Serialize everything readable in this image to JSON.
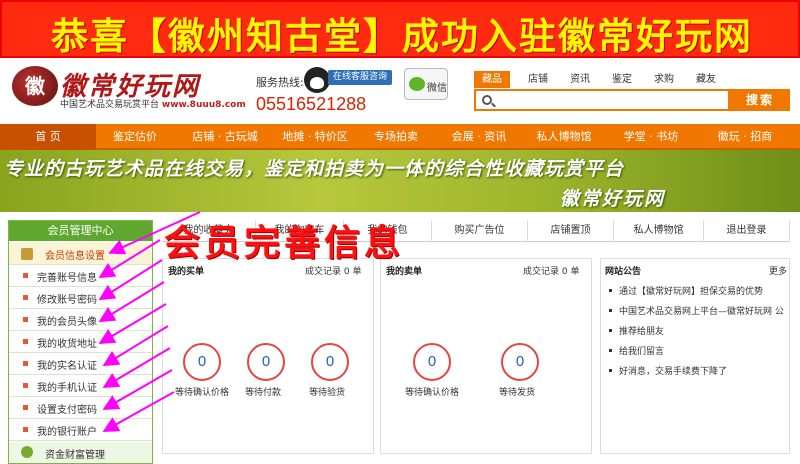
{
  "banner": {
    "text": "恭喜【徽州知古堂】成功入驻徽常好玩网"
  },
  "logo": {
    "mark": "徽",
    "name": "徽常好玩网",
    "tagline": "中国艺术品交易玩赏平台",
    "domain": "www.8uuu8.com"
  },
  "header": {
    "hotline_label": "服务热线:",
    "qq_button": "在线客服咨询",
    "phone": "05516521288",
    "wechat_label": "微信"
  },
  "search": {
    "tabs": [
      "藏品",
      "店铺",
      "资讯",
      "鉴定",
      "求购",
      "藏友"
    ],
    "active_tab": "藏品",
    "placeholder": "",
    "button": "搜索"
  },
  "nav": [
    "首 页",
    "鉴定估价",
    "店铺 · 古玩城",
    "地摊 · 特价区",
    "专场拍卖",
    "会展 · 资讯",
    "私人博物馆",
    "学堂 · 书坊",
    "徽玩 · 招商"
  ],
  "slogan": {
    "line1": "专业的古玩艺术品在线交易，鉴定和拍卖为一体的综合性收藏玩赏平台",
    "line2": "徽常好玩网"
  },
  "sidebar": {
    "header": "会员管理中心",
    "items": [
      "会员信息设置",
      "完善账号信息",
      "修改账号密码",
      "我的会员头像",
      "我的收货地址",
      "我的实名认证",
      "我的手机认证",
      "设置支付密码",
      "我的银行账户"
    ],
    "footer": "资金财富管理"
  },
  "tabs": [
    "我的收藏夹",
    "我的淘宝车",
    "我的钱包",
    "购买广告位",
    "店铺置顶",
    "私人博物馆",
    "退出登录"
  ],
  "buy_panel": {
    "title": "我的买单",
    "record_label": "成交记录",
    "record_count": "0",
    "record_unit": "单",
    "counters": [
      {
        "value": "0",
        "label": "等待确认价格"
      },
      {
        "value": "0",
        "label": "等待付款"
      },
      {
        "value": "0",
        "label": "等待验货"
      }
    ]
  },
  "sell_panel": {
    "title": "我的卖单",
    "record_label": "成交记录",
    "record_count": "0",
    "record_unit": "单",
    "counters": [
      {
        "value": "0",
        "label": "等待确认价格"
      },
      {
        "value": "0",
        "label": "等待发货"
      }
    ]
  },
  "news": {
    "title": "网站公告",
    "more": "更多",
    "items": [
      "通过【徽常好玩网】担保交易的优势",
      "中国艺术品交易网上平台—徽常好玩网 公",
      "推荐给朋友",
      "给我们留言",
      "好消息，交易手续费下降了"
    ]
  },
  "overlay": {
    "text": "会员完善信息"
  },
  "colors": {
    "banner_bg": "#ff2a10",
    "banner_text": "#fff600",
    "accent": "#f07800",
    "sidebar_green": "#5ea830",
    "arrow": "#ff00ff",
    "overlay": "#ff1010"
  }
}
